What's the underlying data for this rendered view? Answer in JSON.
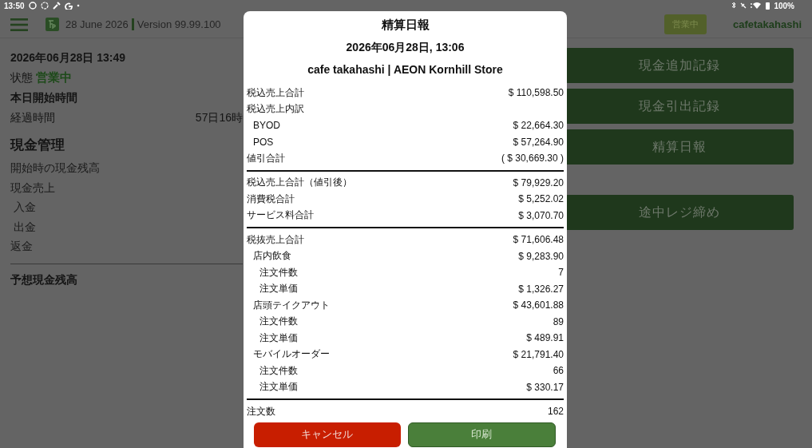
{
  "status_bar": {
    "time": "13:50",
    "battery": "100%"
  },
  "header": {
    "date": "28 June 2026",
    "version": "Version 99.99.100",
    "status_badge": "営業中",
    "user": "cafetakahashi"
  },
  "summary": {
    "datetime": "2026年06月28日 13:49",
    "state_label": "状態",
    "state_value": "営業中",
    "start_label": "本日開始時間",
    "elapsed_label": "経過時間",
    "elapsed_value": "57日16時"
  },
  "cash": {
    "title": "現金管理",
    "rows": [
      {
        "label": "開始時の現金残高"
      },
      {
        "label": "現金売上",
        "children": [
          {
            "label": "入金"
          },
          {
            "label": "出金"
          }
        ]
      },
      {
        "label": "返金"
      }
    ],
    "total_label": "予想現金残高"
  },
  "actions": [
    {
      "label": "現金追加記録"
    },
    {
      "label": "現金引出記録"
    },
    {
      "label": "精算日報"
    }
  ],
  "secondary_actions": [
    {
      "label": "途中レジ締め"
    }
  ],
  "dialog": {
    "title": "精算日報",
    "datetime": "2026年06月28日, 13:06",
    "store": "cafe takahashi | AEON Kornhill Store",
    "sections": [
      {
        "rows": [
          {
            "label": "税込売上合計",
            "value": "$ 110,598.50"
          },
          {
            "label": "税込売上内訳",
            "children": [
              {
                "label": "BYOD",
                "value": "$ 22,664.30"
              },
              {
                "label": "POS",
                "value": "$ 57,264.90"
              }
            ]
          },
          {
            "label": "値引合計",
            "value": "( $ 30,669.30 )"
          }
        ]
      },
      {
        "rows": [
          {
            "label": "税込売上合計（値引後）",
            "value": "$ 79,929.20"
          },
          {
            "label": "消費税合計",
            "value": "$ 5,252.02"
          },
          {
            "label": "サービス料合計",
            "value": "$ 3,070.70"
          }
        ]
      },
      {
        "rows": [
          {
            "label": "税抜売上合計",
            "value": "$ 71,606.48",
            "children": [
              {
                "label": "店内飲食",
                "value": "$ 9,283.90",
                "children": [
                  {
                    "label": "注文件数",
                    "value": "7"
                  },
                  {
                    "label": "注文単価",
                    "value": "$ 1,326.27"
                  }
                ]
              },
              {
                "label": "店頭テイクアウト",
                "value": "$ 43,601.88",
                "children": [
                  {
                    "label": "注文件数",
                    "value": "89"
                  },
                  {
                    "label": "注文単価",
                    "value": "$ 489.91"
                  }
                ]
              },
              {
                "label": "モバイルオーダー",
                "value": "$ 21,791.40",
                "children": [
                  {
                    "label": "注文件数",
                    "value": "66"
                  },
                  {
                    "label": "注文単価",
                    "value": "$ 330.17"
                  }
                ]
              }
            ]
          }
        ]
      },
      {
        "rows": [
          {
            "label": "注文数",
            "value": "162"
          }
        ]
      }
    ],
    "cancel": "キャンセル",
    "print": "印刷"
  }
}
